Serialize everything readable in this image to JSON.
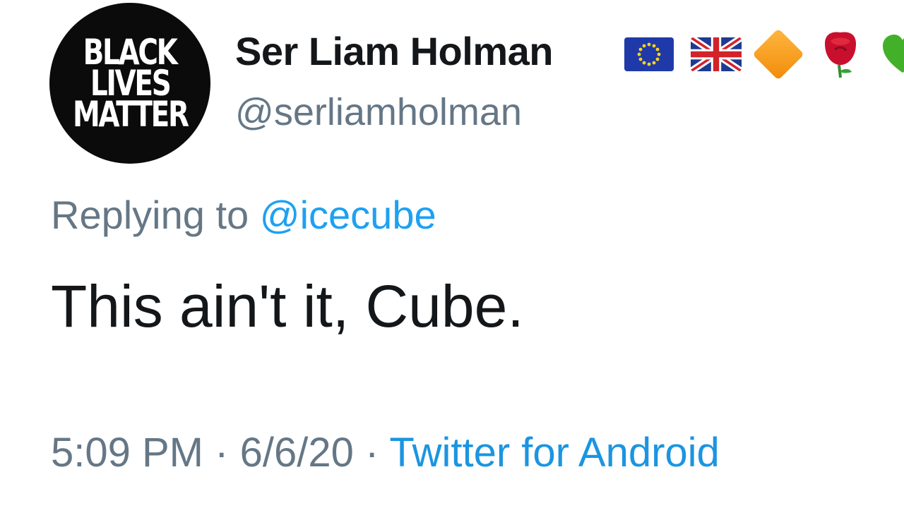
{
  "avatar": {
    "lines": [
      "BLACK",
      "LIVES",
      "MATTER"
    ]
  },
  "user": {
    "display_name": "Ser Liam Holman",
    "handle": "@serliamholman",
    "badges": [
      "eu-flag-icon",
      "uk-flag-icon",
      "orange-diamond-icon",
      "rose-icon",
      "green-heart-icon"
    ]
  },
  "reply": {
    "prefix": "Replying to",
    "mention": "@icecube"
  },
  "tweet": {
    "text": "This ain't it, Cube."
  },
  "meta": {
    "time": "5:09 PM",
    "separator": "·",
    "date": "6/6/20",
    "source": "Twitter for Android"
  },
  "colors": {
    "text": "#14171a",
    "secondary": "#657786",
    "link": "#1da1f2",
    "avatar_bg": "#0b0b0b"
  }
}
